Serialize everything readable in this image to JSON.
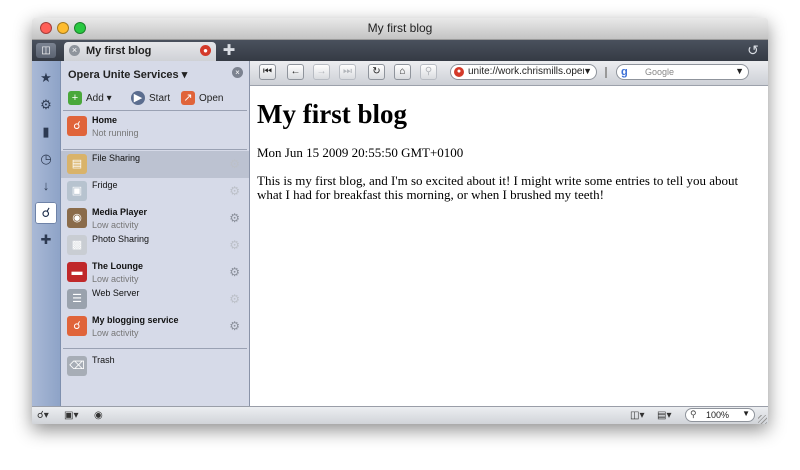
{
  "window": {
    "title": "My first blog",
    "controls": {
      "close_color": "#ff5f57",
      "minimize_color": "#febc2e",
      "zoom_color": "#28c840"
    }
  },
  "tabs": [
    {
      "label": "My first blog",
      "active": true
    }
  ],
  "panel": {
    "title": "Opera Unite Services",
    "buttons": [
      {
        "label": "Add",
        "icon": "plus-icon"
      },
      {
        "label": "Start",
        "icon": "play-icon"
      },
      {
        "label": "Open",
        "icon": "open-icon"
      }
    ],
    "services": [
      {
        "name": "Home",
        "status": "Not running",
        "icon": "unite-home-icon",
        "color": "#e0643a"
      },
      {
        "name": "File Sharing",
        "status": "",
        "icon": "folder-icon",
        "color": "#d9b36a"
      },
      {
        "name": "Fridge",
        "status": "",
        "icon": "fridge-icon",
        "color": "#b7c3cf"
      },
      {
        "name": "Media Player",
        "status": "Low activity",
        "icon": "speaker-icon",
        "color": "#8a6b4a"
      },
      {
        "name": "Photo Sharing",
        "status": "",
        "icon": "photo-icon",
        "color": "#c9cdd3"
      },
      {
        "name": "The Lounge",
        "status": "Low activity",
        "icon": "sofa-icon",
        "color": "#c0282a"
      },
      {
        "name": "Web Server",
        "status": "",
        "icon": "server-icon",
        "color": "#9aa2ad"
      },
      {
        "name": "My blogging service",
        "status": "Low activity",
        "icon": "unite-blog-icon",
        "color": "#e0643a"
      },
      {
        "name": "Trash",
        "status": "",
        "icon": "trash-icon",
        "color": "#a7adb6"
      }
    ]
  },
  "toolbar": {
    "address": "unite://work.chrismills.operaunite.com/blog/",
    "search_engine": "Google"
  },
  "page": {
    "title": "My first blog",
    "date": "Mon Jun 15 2009 20:55:50 GMT+0100",
    "body": "This is my first blog, and I'm so excited about it! I might write some entries to tell you about what I had for breakfast this morning, or when I brushed my teeth!"
  },
  "statusbar": {
    "zoom": "100%"
  },
  "colors": {
    "sidebar_accent": "#8ea3c7",
    "unite_red": "#d43a2a",
    "panel_bg": "#d6dae8"
  }
}
